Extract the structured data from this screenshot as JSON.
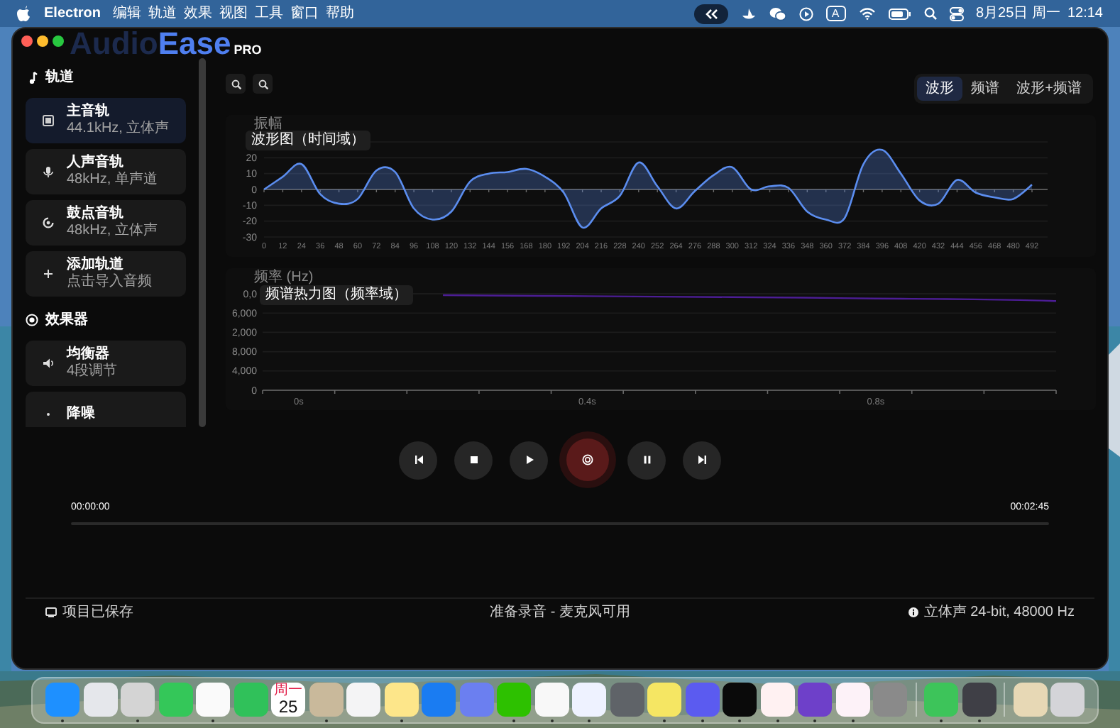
{
  "menu_bar": {
    "app": "Electron",
    "menus": [
      "编辑",
      "轨道",
      "效果",
      "视图",
      "工具",
      "窗口",
      "帮助"
    ],
    "input_mode": "A",
    "date": "8月25日 周一",
    "time": "12:14"
  },
  "window": {
    "logo": {
      "dim": "Audio",
      "bright": "Ease",
      "badge": "PRO"
    }
  },
  "sidebar": {
    "sections": [
      {
        "kind": "tracks",
        "title": "轨道",
        "items": [
          {
            "kind": "master",
            "title": "主音轨",
            "subtitle": "44.1kHz, 立体声",
            "selected": true
          },
          {
            "kind": "vocal",
            "title": "人声音轨",
            "subtitle": "48kHz, 单声道",
            "selected": false
          },
          {
            "kind": "drum",
            "title": "鼓点音轨",
            "subtitle": "48kHz, 立体声",
            "selected": false
          },
          {
            "kind": "add",
            "title": "添加轨道",
            "subtitle": "点击导入音频",
            "selected": false
          }
        ]
      },
      {
        "kind": "effects",
        "title": "效果器",
        "items": [
          {
            "kind": "equalizer",
            "title": "均衡器",
            "subtitle": "4段调节",
            "selected": false
          },
          {
            "kind": "denoise",
            "title": "降噪",
            "selected": false
          }
        ]
      }
    ]
  },
  "view_tabs": [
    {
      "label": "波形",
      "selected": true
    },
    {
      "label": "频谱",
      "selected": false
    },
    {
      "label": "波形+频谱",
      "selected": false
    }
  ],
  "waveform": {
    "title": "波形图（时间域）",
    "chart_data": {
      "type": "area",
      "ylabel": "振幅",
      "grid": true,
      "x": [
        0,
        12,
        24,
        36,
        48,
        60,
        72,
        84,
        96,
        108,
        120,
        132,
        144,
        156,
        168,
        180,
        192,
        204,
        216,
        228,
        240,
        252,
        264,
        276,
        288,
        300,
        312,
        324,
        336,
        348,
        360,
        372,
        384,
        396,
        408,
        420,
        432,
        444,
        456,
        468,
        480,
        492
      ],
      "series": [
        {
          "color": "#5b8def",
          "values": [
            0,
            8,
            16,
            -3,
            -9,
            -6,
            12,
            11,
            -12,
            -19,
            -14,
            5,
            10,
            11,
            13,
            8,
            -2,
            -24,
            -12,
            -4,
            17,
            2,
            -12,
            -1,
            9,
            14,
            0,
            2,
            1,
            -14,
            -19,
            -18,
            16,
            25,
            10,
            -7,
            -9,
            6,
            -2,
            -5,
            -6,
            3
          ]
        }
      ],
      "xlim": [
        0,
        502
      ],
      "ylim": [
        -30,
        30
      ],
      "xticks": [
        0,
        12,
        24,
        36,
        48,
        60,
        72,
        84,
        96,
        108,
        120,
        132,
        144,
        156,
        168,
        180,
        192,
        204,
        216,
        228,
        240,
        252,
        264,
        276,
        288,
        300,
        312,
        324,
        336,
        348,
        360,
        372,
        384,
        396,
        408,
        420,
        432,
        444,
        456,
        468,
        480,
        492
      ],
      "yticks": [
        20,
        10,
        0,
        -10,
        -20,
        -30
      ]
    }
  },
  "spectrum": {
    "title": "频谱热力图（频率域）",
    "cut_tick_labels": [
      "0,0",
      "6,000",
      "2,000"
    ],
    "chart_data": {
      "type": "line",
      "ylabel": "频率 (Hz)",
      "grid": true,
      "x": [
        0.2,
        0.3,
        0.4,
        0.5,
        0.6,
        0.7,
        0.8,
        0.9,
        1.0,
        1.05
      ],
      "series": [
        {
          "color": "#4c1d95",
          "values": [
            19700,
            19600,
            19500,
            19400,
            19300,
            19200,
            19000,
            18900,
            18700,
            18500
          ]
        }
      ],
      "xlim": [
        -0.05,
        1.05
      ],
      "ylim": [
        0,
        20000
      ],
      "xticks": [
        {
          "value": 0,
          "label": "0s"
        },
        {
          "value": 0.4,
          "label": "0.4s"
        },
        {
          "value": 0.8,
          "label": "0.8s"
        }
      ],
      "yticks": [
        {
          "value": 8000,
          "label": "8,000"
        },
        {
          "value": 4000,
          "label": "4,000"
        },
        {
          "value": 0,
          "label": "0"
        }
      ]
    }
  },
  "transport": [
    {
      "kind": "skip_back"
    },
    {
      "kind": "stop"
    },
    {
      "kind": "play"
    },
    {
      "kind": "record"
    },
    {
      "kind": "pause"
    },
    {
      "kind": "skip_forward"
    }
  ],
  "timeline": {
    "start": "00:00:00",
    "end": "00:02:45",
    "level": 0
  },
  "status_bar": {
    "left": "项目已保存",
    "center": "准备录音 - 麦克风可用",
    "right": "立体声 24-bit, 48000 Hz"
  },
  "dock": {
    "apps": [
      {
        "kind": "app",
        "color": "#1e90ff",
        "running": true
      },
      {
        "kind": "app",
        "color": "#e5e7eb",
        "running": false
      },
      {
        "kind": "app",
        "color": "#d4d4d4",
        "running": true
      },
      {
        "kind": "app",
        "color": "#34c759",
        "running": false
      },
      {
        "kind": "app",
        "color": "#fafafa",
        "running": true
      },
      {
        "kind": "app",
        "color": "#30c15a",
        "running": false
      },
      {
        "kind": "calendar",
        "color": "#ffffff",
        "weekday": "周一",
        "day": "25",
        "running": false
      },
      {
        "kind": "app",
        "color": "#c9b99b",
        "running": true
      },
      {
        "kind": "app",
        "color": "#f4f4f5",
        "running": false
      },
      {
        "kind": "app",
        "color": "#fde68a",
        "running": true
      },
      {
        "kind": "app",
        "color": "#1a7cf2",
        "running": false
      },
      {
        "kind": "app",
        "color": "#6b7ff0",
        "running": false
      },
      {
        "kind": "app",
        "color": "#2dc100",
        "running": true
      },
      {
        "kind": "app",
        "color": "#f8f8f8",
        "running": true
      },
      {
        "kind": "app",
        "color": "#eef2ff",
        "running": true
      },
      {
        "kind": "app",
        "color": "#5f6368",
        "running": false
      },
      {
        "kind": "app",
        "color": "#f5e663",
        "running": true
      },
      {
        "kind": "app",
        "color": "#5b5bf0",
        "running": true
      },
      {
        "kind": "app",
        "color": "#0a0a0a",
        "running": true
      },
      {
        "kind": "app",
        "color": "#fff1f2",
        "running": true
      },
      {
        "kind": "app",
        "color": "#6e40c9",
        "running": true
      },
      {
        "kind": "app",
        "color": "#fdf2f8",
        "running": true
      },
      {
        "kind": "app",
        "color": "#8a8a8a",
        "running": false
      },
      {
        "kind": "divider"
      },
      {
        "kind": "app",
        "color": "#3dc45a",
        "running": true
      },
      {
        "kind": "app",
        "color": "#3f3f46",
        "running": true
      },
      {
        "kind": "divider"
      },
      {
        "kind": "app",
        "color": "#e7d8b5",
        "running": false
      },
      {
        "kind": "app",
        "color": "#d4d4d8",
        "running": false
      }
    ]
  }
}
